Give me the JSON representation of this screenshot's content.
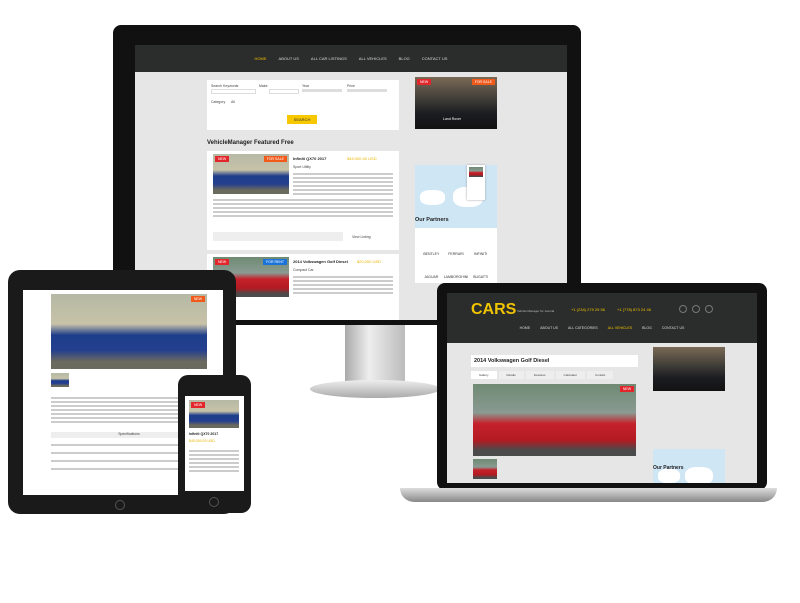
{
  "desktop": {
    "nav": [
      "HOME",
      "ABOUT US",
      "ALL CAR LISTINGS",
      "ALL VEHICLES",
      "BLOG",
      "CONTACT US"
    ],
    "search": {
      "keywords_label": "Search Keywords",
      "make_label": "Make",
      "year_label": "Year",
      "price_label": "Price",
      "category_label": "Category",
      "category_value": "All",
      "button": "SEARCH"
    },
    "featured_title": "VehicleManager Featured Free",
    "listings": [
      {
        "title": "Infiniti QX70 2017",
        "price": "$45,000.00 USD",
        "badge_left": "NEW",
        "badge_right": "FOR SALE",
        "location": "Sport Utility",
        "more": "View Listing"
      },
      {
        "title": "2014 Volkswagen Golf Diesel",
        "price": "$20,000 USD",
        "badge_left": "NEW",
        "badge_right": "FOR RENT",
        "location": "Compact Car"
      }
    ],
    "ad": {
      "badge_left": "NEW",
      "badge_right": "FOR SALE",
      "caption": "Land Rover"
    },
    "partners_title": "Our Partners",
    "partners": [
      "BENTLEY",
      "FERRARI",
      "INFINITI",
      "JAGUAR",
      "LAMBORGHINI",
      "BUGATTI"
    ]
  },
  "laptop": {
    "brand": "CARS",
    "tagline": "Vehicle Manager for Joomla",
    "phone1": "+1 (234) 279 29 56",
    "phone2": "+1 (778) 873 24 46",
    "nav": [
      "HOME",
      "ABOUT US",
      "ALL CATEGORIES",
      "ALL VEHICLES",
      "BLOG",
      "CONTACT US"
    ],
    "title": "2014 Volkswagen Golf Diesel",
    "tabs": [
      "Gallery",
      "Details",
      "Features",
      "Calculator",
      "Contact"
    ],
    "partners_title": "Our Partners",
    "badge": "NEW"
  },
  "tablet": {
    "badge": "NEW",
    "section": "Specifications"
  },
  "phone": {
    "title": "Infiniti QX70 2017",
    "price": "$45,000.00 USD",
    "badge": "NEW"
  }
}
